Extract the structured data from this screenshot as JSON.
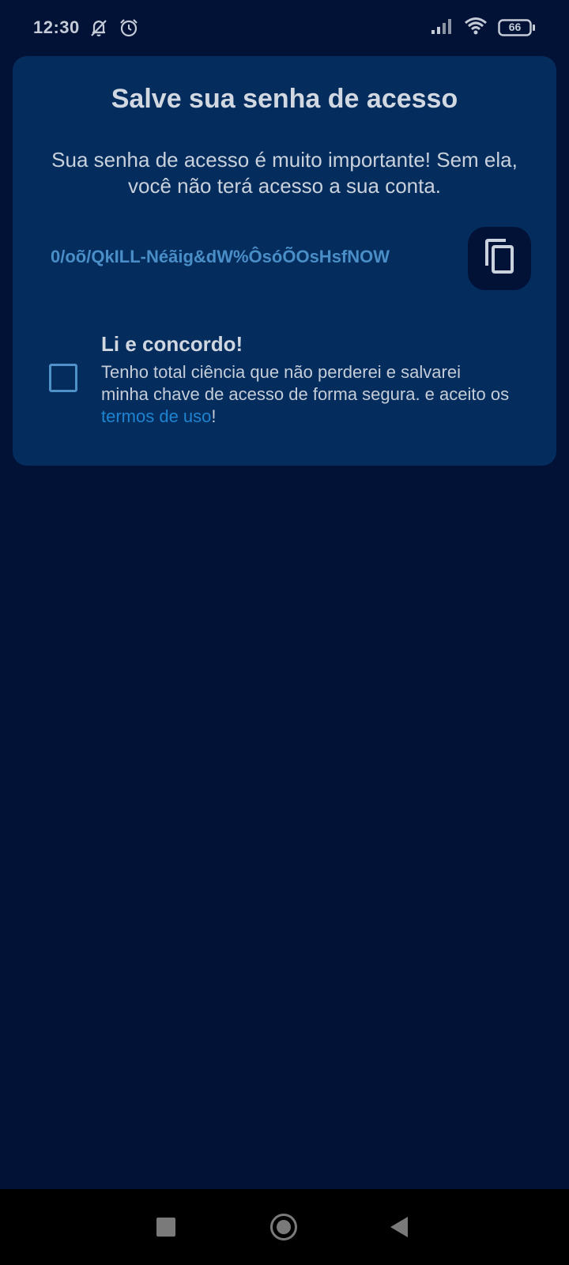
{
  "status_bar": {
    "time": "12:30",
    "icons": [
      "bell-off-icon",
      "alarm-icon",
      "signal-icon",
      "wifi-icon",
      "battery-icon"
    ],
    "battery": "66"
  },
  "dialog": {
    "title": "Salve sua senha de acesso",
    "description": "Sua senha de acesso é muito importante! Sem ela, você não terá acesso a sua conta.",
    "access_key": "0/oõ/QkILL-Néãig&dW%ÔsóÕOsHsfNOW",
    "copy_icon": "copy-icon",
    "agreement": {
      "title": "Li e concordo!",
      "text_before": "Tenho total ciência que não perderei e salvarei minha chave de acesso de forma segura. e aceito os ",
      "link": "termos de uso",
      "text_after": "!",
      "checked": false
    }
  },
  "colors": {
    "background": "#021237",
    "card": "#042c5c",
    "key_text": "#4a8ec8",
    "link": "#1f84d0"
  },
  "nav_bar": {
    "icons": [
      "recents-icon",
      "home-icon",
      "back-icon"
    ]
  }
}
